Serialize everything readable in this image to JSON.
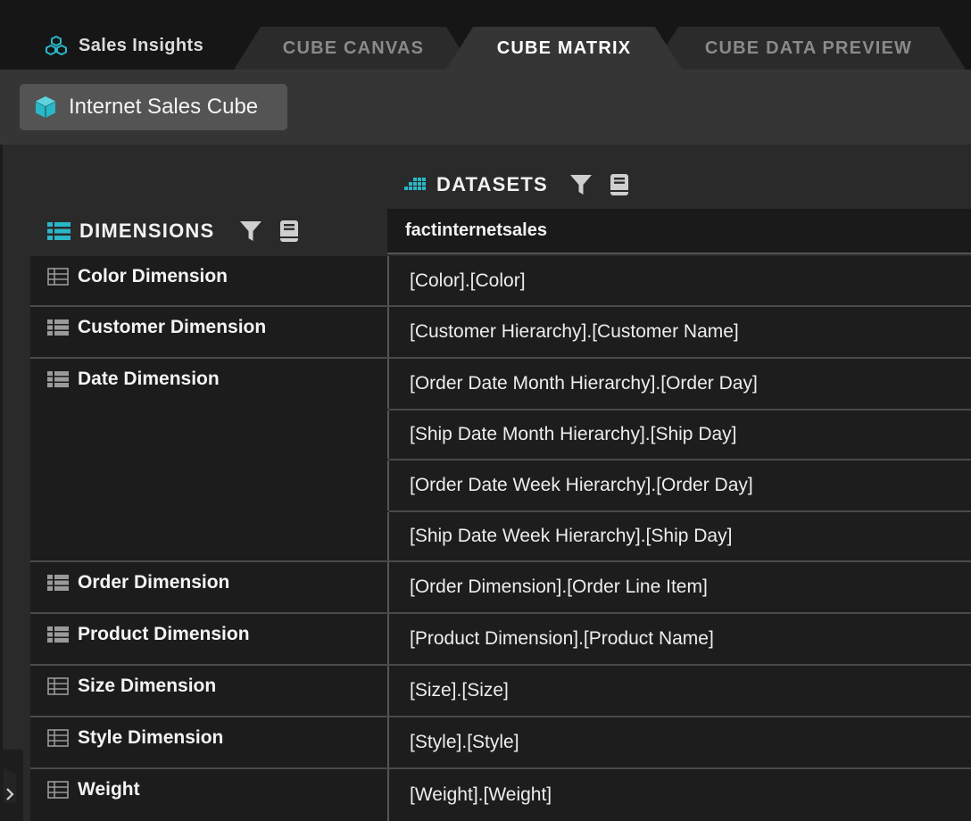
{
  "app": {
    "title": "Sales Insights",
    "icon": "cubes-icon",
    "accent_color": "#29b8c8"
  },
  "tabs": [
    {
      "label": "CUBE CANVAS",
      "active": false
    },
    {
      "label": "CUBE MATRIX",
      "active": true
    },
    {
      "label": "CUBE DATA PREVIEW",
      "active": false
    }
  ],
  "toolbar": {
    "cube_name": "Internet Sales Cube",
    "cube_icon": "cube-icon"
  },
  "datasets": {
    "label": "DATASETS",
    "icon": "datasets-grid-icon",
    "filter_icon": "filter-icon",
    "notes_icon": "notebook-icon",
    "columns": [
      "factinternetsales"
    ]
  },
  "dimensions": {
    "label": "DIMENSIONS",
    "icon": "dimensions-list-icon",
    "filter_icon": "filter-icon",
    "notes_icon": "notebook-icon",
    "rows": [
      {
        "name": "Color Dimension",
        "icon": "table-icon",
        "values": [
          "[Color].[Color]"
        ]
      },
      {
        "name": "Customer Dimension",
        "icon": "hierarchy-list-icon",
        "values": [
          "[Customer Hierarchy].[Customer Name]"
        ]
      },
      {
        "name": "Date Dimension",
        "icon": "hierarchy-list-icon",
        "values": [
          "[Order Date Month Hierarchy].[Order Day]",
          "[Ship Date Month Hierarchy].[Ship Day]",
          "[Order Date Week Hierarchy].[Order Day]",
          "[Ship Date Week Hierarchy].[Ship Day]"
        ]
      },
      {
        "name": "Order Dimension",
        "icon": "hierarchy-list-icon",
        "values": [
          "[Order Dimension].[Order Line Item]"
        ]
      },
      {
        "name": "Product Dimension",
        "icon": "hierarchy-list-icon",
        "values": [
          "[Product Dimension].[Product Name]"
        ]
      },
      {
        "name": "Size Dimension",
        "icon": "table-icon",
        "values": [
          "[Size].[Size]"
        ]
      },
      {
        "name": "Style Dimension",
        "icon": "table-icon",
        "values": [
          "[Style].[Style]"
        ]
      },
      {
        "name": "Weight",
        "icon": "table-icon",
        "values": [
          "[Weight].[Weight]"
        ]
      }
    ]
  },
  "sidebar_toggle_icon": "chevron-right-icon"
}
